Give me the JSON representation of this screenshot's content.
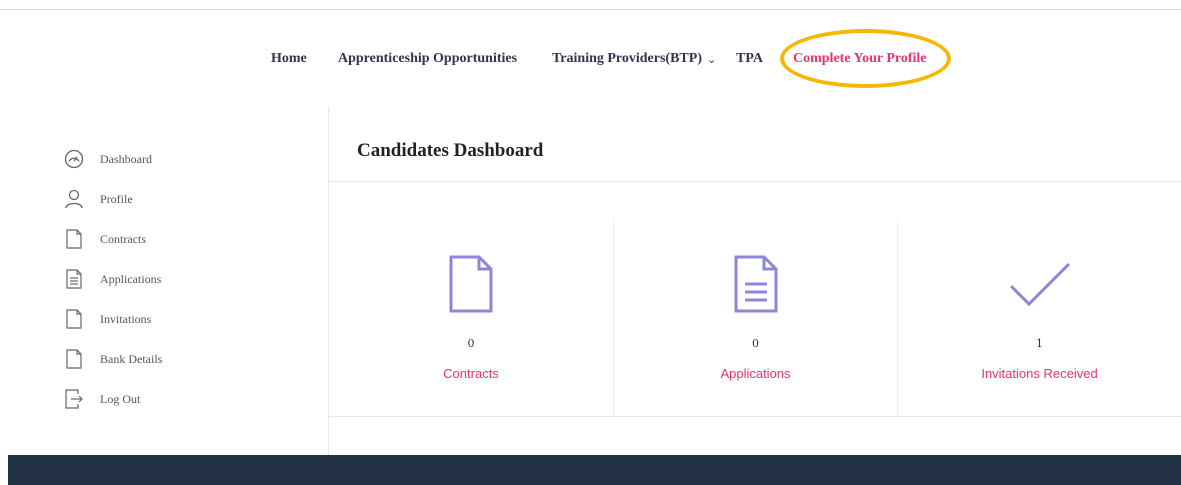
{
  "nav": {
    "items": [
      {
        "label": "Home"
      },
      {
        "label": "Apprenticeship Opportunities"
      },
      {
        "label": "Training Providers(BTP)",
        "chevron": "⌄"
      },
      {
        "label": "TPA"
      },
      {
        "label": "Complete Your Profile",
        "highlighted": true
      }
    ]
  },
  "sidebar": {
    "items": [
      {
        "label": "Dashboard",
        "icon": "dashboard-gauge-icon"
      },
      {
        "label": "Profile",
        "icon": "user-icon"
      },
      {
        "label": "Contracts",
        "icon": "document-icon"
      },
      {
        "label": "Applications",
        "icon": "document-lines-icon"
      },
      {
        "label": "Invitations",
        "icon": "document-icon"
      },
      {
        "label": "Bank Details",
        "icon": "document-icon"
      },
      {
        "label": "Log Out",
        "icon": "logout-arrow-icon"
      }
    ]
  },
  "main": {
    "title": "Candidates Dashboard",
    "cards": [
      {
        "count": "0",
        "label": "Contracts",
        "icon": "document-icon"
      },
      {
        "count": "0",
        "label": "Applications",
        "icon": "document-lines-icon"
      },
      {
        "count": "1",
        "label": "Invitations Received",
        "icon": "checkmark-icon"
      }
    ]
  },
  "colors": {
    "accent_pink": "#e8336c",
    "icon_purple": "#8c86d9",
    "nav_text": "#33334d",
    "highlight_ring": "#f5b800",
    "footer_bg": "#243247"
  }
}
